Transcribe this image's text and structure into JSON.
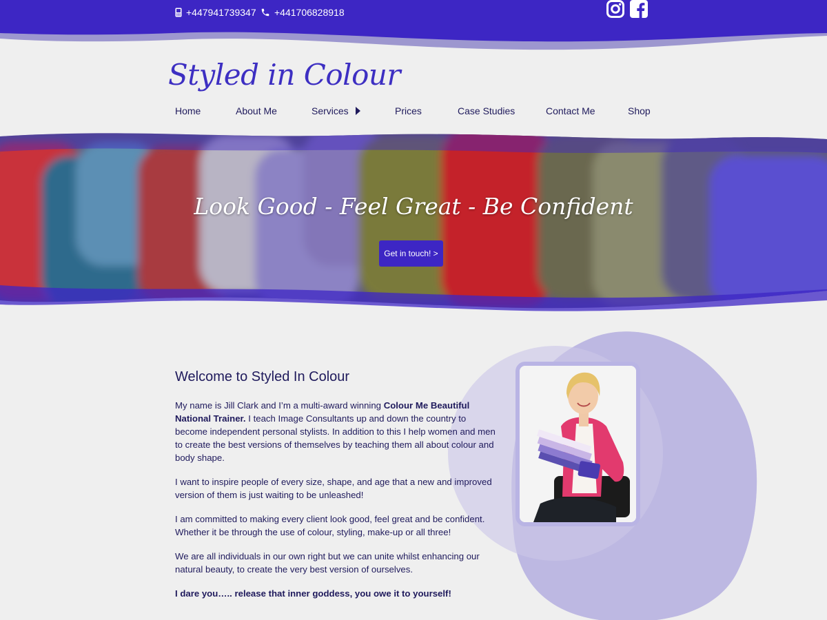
{
  "topbar": {
    "phone_mobile": "+447941739347",
    "phone_landline": "+441706828918",
    "colors": {
      "bar": "#3d26c4",
      "wave_light": "#9d97cf"
    }
  },
  "social": {
    "instagram_icon": "instagram-icon",
    "facebook_icon": "facebook-icon"
  },
  "site": {
    "logo": "Styled in Colour"
  },
  "nav": {
    "items": [
      "Home",
      "About Me",
      "Services",
      "Prices",
      "Case Studies",
      "Contact Me",
      "Shop"
    ]
  },
  "hero": {
    "title": "Look Good - Feel Great - Be Confident",
    "button": "Get in touch! >"
  },
  "welcome": {
    "heading": "Welcome to Styled In Colour",
    "p1_a": "My name is Jill Clark and I’m a multi-award winning ",
    "p1_b": "Colour Me Beautiful National Trainer.",
    "p1_c": " I teach Image Consultants up and down the country to become independent personal stylists. In addition to this I help women and men to create the best versions of themselves by teaching them all about colour and body shape.",
    "p2": "I want to inspire people of every size, shape, and age that a new and improved version of them is just waiting to be unleashed!",
    "p3": "I am committed to making every client look good, feel great and be confident. Whether it be through the use of colour, styling, make-up or all three!",
    "p4": "We are all individuals in our own right but we can unite whilst enhancing our natural beauty, to create the very best version of ourselves.",
    "p5": "I dare you….. release that inner goddess, you owe it to yourself!"
  }
}
